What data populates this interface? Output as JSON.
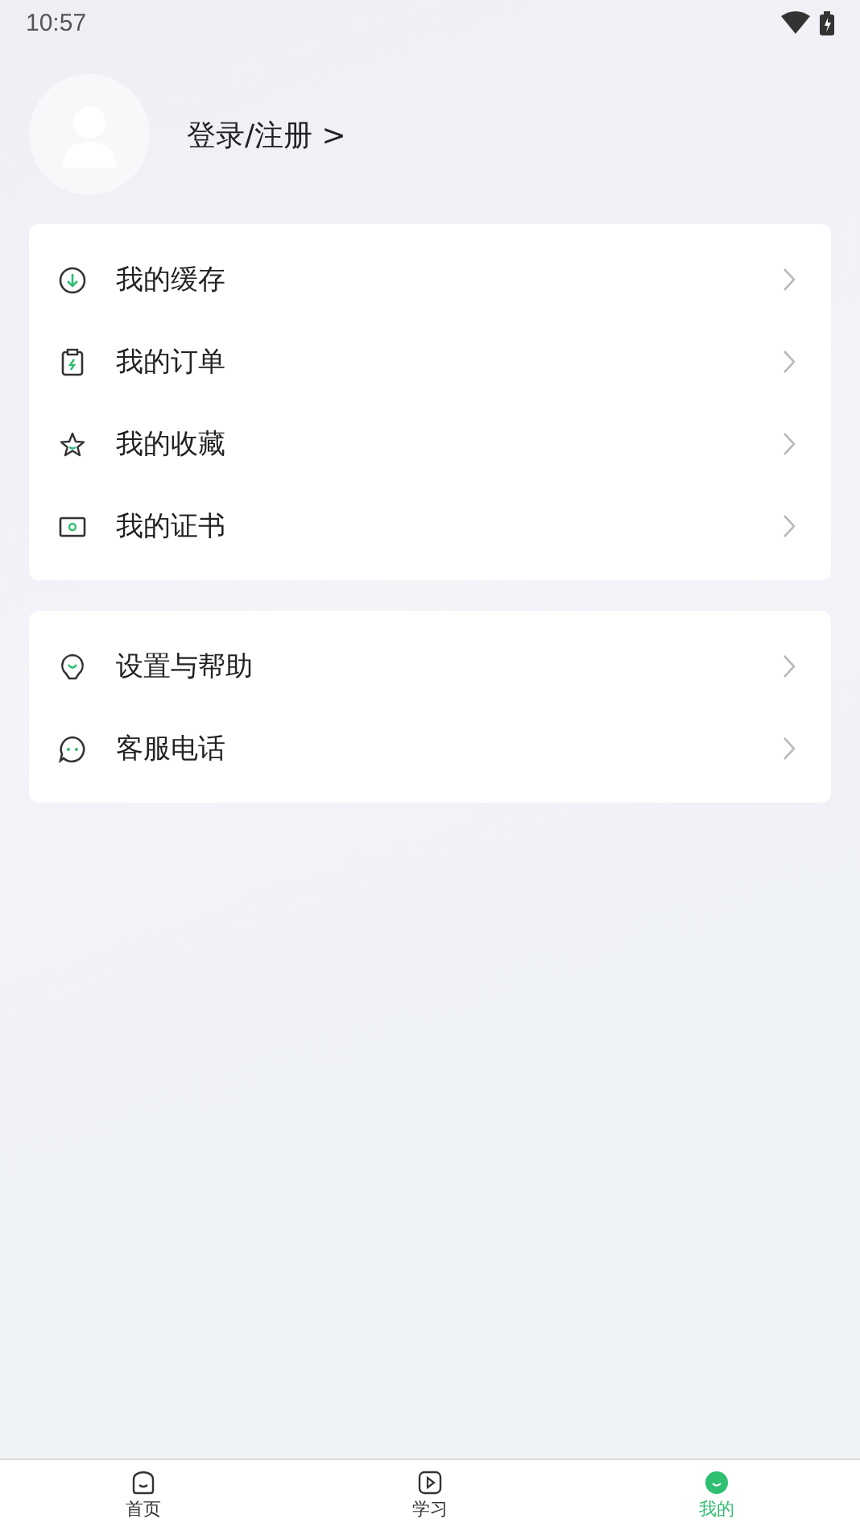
{
  "status_bar": {
    "time": "10:57"
  },
  "profile": {
    "login_label": "登录/注册 >"
  },
  "menu_groups": [
    {
      "items": [
        {
          "label": "我的缓存"
        },
        {
          "label": "我的订单"
        },
        {
          "label": "我的收藏"
        },
        {
          "label": "我的证书"
        }
      ]
    },
    {
      "items": [
        {
          "label": "设置与帮助"
        },
        {
          "label": "客服电话"
        }
      ]
    }
  ],
  "tab_bar": [
    {
      "label": "首页",
      "selected": false
    },
    {
      "label": "学习",
      "selected": false
    },
    {
      "label": "我的",
      "selected": true
    }
  ]
}
